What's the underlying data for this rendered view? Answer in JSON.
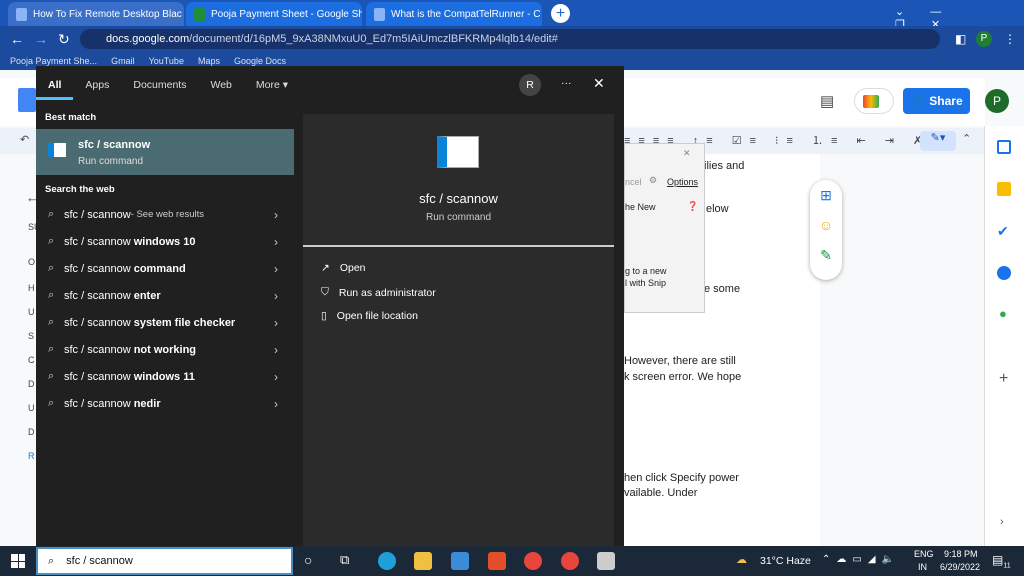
{
  "browser": {
    "tabs": [
      {
        "title": "How To Fix Remote Desktop Blac"
      },
      {
        "title": "Pooja Payment Sheet - Google Sh"
      },
      {
        "title": "What is the CompatTelRunner - C"
      }
    ],
    "url_domain": "docs.google.com",
    "url_path": "/document/d/16pM5_9xA38NMxuU0_Ed7m5IAiUmczlBFKRMp4lqlb14/edit#",
    "bookmarks": [
      "Pooja Payment She...",
      "Gmail",
      "YouTube",
      "Maps",
      "Google Docs"
    ]
  },
  "docs": {
    "share_label": "Share",
    "avatar": "P",
    "body_fragments": [
      "ilies and",
      "elow",
      "e some",
      "However, there are still",
      "k screen error. We hope",
      "hen click Specify power",
      "vailable. Under"
    ],
    "margin_letters": [
      "SU",
      "O",
      "H",
      "U",
      "S",
      "C",
      "D",
      "U",
      "D",
      "R"
    ],
    "dialog": {
      "cancel": "ncel",
      "options": "Options",
      "new": "he New",
      "snip1": "g to a new",
      "snip2": "l with Snip"
    }
  },
  "search": {
    "tabs": [
      "All",
      "Apps",
      "Documents",
      "Web",
      "More"
    ],
    "user_initial": "R",
    "best_match_label": "Best match",
    "best": {
      "title": "sfc / scannow",
      "subtitle": "Run command"
    },
    "web_label": "Search the web",
    "web_results": [
      {
        "query": "sfc / scannow",
        "suffix": " - See web results"
      },
      {
        "query": "sfc / scannow ",
        "bold": "windows 10"
      },
      {
        "query": "sfc / scannow ",
        "bold": "command"
      },
      {
        "query": "sfc / scannow ",
        "bold": "enter"
      },
      {
        "query": "sfc / scannow ",
        "bold": "system file checker"
      },
      {
        "query": "sfc / scannow ",
        "bold": "not working"
      },
      {
        "query": "sfc / scannow ",
        "bold": "windows 11"
      },
      {
        "query": "sfc / scannow ",
        "bold": "nedir"
      }
    ],
    "preview": {
      "title": "sfc / scannow",
      "subtitle": "Run command",
      "actions": [
        "Open",
        "Run as administrator",
        "Open file location"
      ]
    },
    "input_value": "sfc / scannow"
  },
  "taskbar": {
    "weather": "31°C  Haze",
    "lang1": "ENG",
    "lang2": "IN",
    "time": "9:18 PM",
    "date": "6/29/2022",
    "notifications": "11"
  }
}
